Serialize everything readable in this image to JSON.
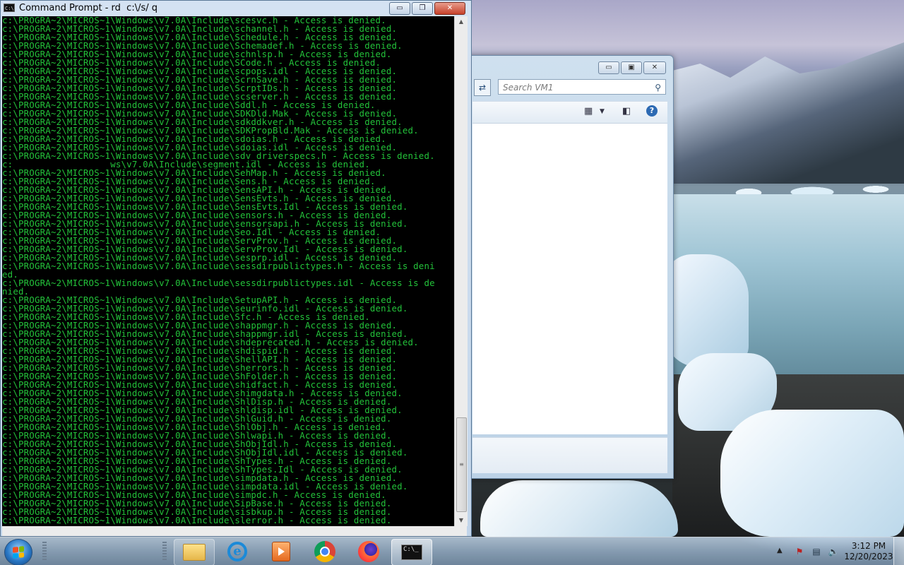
{
  "cmd_window": {
    "title": "Command Prompt - rd  c:\\/s/ q",
    "icon_label": "C:\\",
    "controls": {
      "minimize": "▭",
      "maximize": "❐",
      "close": "✕"
    },
    "lines": [
      "c:\\PROGRA~2\\MICROS~1\\Windows\\v7.0A\\Include\\scesvc.h - Access is denied.",
      "c:\\PROGRA~2\\MICROS~1\\Windows\\v7.0A\\Include\\schannel.h - Access is denied.",
      "c:\\PROGRA~2\\MICROS~1\\Windows\\v7.0A\\Include\\Schedule.h - Access is denied.",
      "c:\\PROGRA~2\\MICROS~1\\Windows\\v7.0A\\Include\\Schemadef.h - Access is denied.",
      "c:\\PROGRA~2\\MICROS~1\\Windows\\v7.0A\\Include\\schnlsp.h - Access is denied.",
      "c:\\PROGRA~2\\MICROS~1\\Windows\\v7.0A\\Include\\SCode.h - Access is denied.",
      "c:\\PROGRA~2\\MICROS~1\\Windows\\v7.0A\\Include\\scpops.idl - Access is denied.",
      "c:\\PROGRA~2\\MICROS~1\\Windows\\v7.0A\\Include\\ScrnSave.h - Access is denied.",
      "c:\\PROGRA~2\\MICROS~1\\Windows\\v7.0A\\Include\\ScrptIDs.h - Access is denied.",
      "c:\\PROGRA~2\\MICROS~1\\Windows\\v7.0A\\Include\\scserver.h - Access is denied.",
      "c:\\PROGRA~2\\MICROS~1\\Windows\\v7.0A\\Include\\Sddl.h - Access is denied.",
      "c:\\PROGRA~2\\MICROS~1\\Windows\\v7.0A\\Include\\SDKDld.Mak - Access is denied.",
      "c:\\PROGRA~2\\MICROS~1\\Windows\\v7.0A\\Include\\sdkddkver.h - Access is denied.",
      "c:\\PROGRA~2\\MICROS~1\\Windows\\v7.0A\\Include\\SDKPropBld.Mak - Access is denied.",
      "c:\\PROGRA~2\\MICROS~1\\Windows\\v7.0A\\Include\\sdoias.h - Access is denied.",
      "c:\\PROGRA~2\\MICROS~1\\Windows\\v7.0A\\Include\\sdoias.idl - Access is denied.",
      "c:\\PROGRA~2\\MICROS~1\\Windows\\v7.0A\\Include\\sdv_driverspecs.h - Access is denied.",
      "c:                  ws\\v7.0A\\Include\\segment.idl - Access is denied.",
      "c:\\PROGRA~2\\MICROS~1\\Windows\\v7.0A\\Include\\SehMap.h - Access is denied.",
      "c:\\PROGRA~2\\MICROS~1\\Windows\\v7.0A\\Include\\Sens.h - Access is denied.",
      "c:\\PROGRA~2\\MICROS~1\\Windows\\v7.0A\\Include\\SensAPI.h - Access is denied.",
      "c:\\PROGRA~2\\MICROS~1\\Windows\\v7.0A\\Include\\SensEvts.h - Access is denied.",
      "c:\\PROGRA~2\\MICROS~1\\Windows\\v7.0A\\Include\\SensEvts.Idl - Access is denied.",
      "c:\\PROGRA~2\\MICROS~1\\Windows\\v7.0A\\Include\\sensors.h - Access is denied.",
      "c:\\PROGRA~2\\MICROS~1\\Windows\\v7.0A\\Include\\sensorsapi.h - Access is denied.",
      "c:\\PROGRA~2\\MICROS~1\\Windows\\v7.0A\\Include\\Seo.Idl - Access is denied.",
      "c:\\PROGRA~2\\MICROS~1\\Windows\\v7.0A\\Include\\ServProv.h - Access is denied.",
      "c:\\PROGRA~2\\MICROS~1\\Windows\\v7.0A\\Include\\ServProv.Idl - Access is denied.",
      "c:\\PROGRA~2\\MICROS~1\\Windows\\v7.0A\\Include\\sesprp.idl - Access is denied.",
      "c:\\PROGRA~2\\MICROS~1\\Windows\\v7.0A\\Include\\sessdirpublictypes.h - Access is deni",
      "ed.",
      "c:\\PROGRA~2\\MICROS~1\\Windows\\v7.0A\\Include\\sessdirpublictypes.idl - Access is de",
      "nied.",
      "c:\\PROGRA~2\\MICROS~1\\Windows\\v7.0A\\Include\\SetupAPI.h - Access is denied.",
      "c:\\PROGRA~2\\MICROS~1\\Windows\\v7.0A\\Include\\seurinfo.idl - Access is denied.",
      "c:\\PROGRA~2\\MICROS~1\\Windows\\v7.0A\\Include\\Sfc.h - Access is denied.",
      "c:\\PROGRA~2\\MICROS~1\\Windows\\v7.0A\\Include\\shappmgr.h - Access is denied.",
      "c:\\PROGRA~2\\MICROS~1\\Windows\\v7.0A\\Include\\shappmgr.idl - Access is denied.",
      "c:\\PROGRA~2\\MICROS~1\\Windows\\v7.0A\\Include\\shdeprecated.h - Access is denied.",
      "c:\\PROGRA~2\\MICROS~1\\Windows\\v7.0A\\Include\\shdispid.h - Access is denied.",
      "c:\\PROGRA~2\\MICROS~1\\Windows\\v7.0A\\Include\\ShellAPI.h - Access is denied.",
      "c:\\PROGRA~2\\MICROS~1\\Windows\\v7.0A\\Include\\sherrors.h - Access is denied.",
      "c:\\PROGRA~2\\MICROS~1\\Windows\\v7.0A\\Include\\ShFolder.h - Access is denied.",
      "c:\\PROGRA~2\\MICROS~1\\Windows\\v7.0A\\Include\\shidfact.h - Access is denied.",
      "c:\\PROGRA~2\\MICROS~1\\Windows\\v7.0A\\Include\\shimgdata.h - Access is denied.",
      "c:\\PROGRA~2\\MICROS~1\\Windows\\v7.0A\\Include\\ShlDisp.h - Access is denied.",
      "c:\\PROGRA~2\\MICROS~1\\Windows\\v7.0A\\Include\\shldisp.idl - Access is denied.",
      "c:\\PROGRA~2\\MICROS~1\\Windows\\v7.0A\\Include\\ShlGuid.h - Access is denied.",
      "c:\\PROGRA~2\\MICROS~1\\Windows\\v7.0A\\Include\\ShlObj.h - Access is denied.",
      "c:\\PROGRA~2\\MICROS~1\\Windows\\v7.0A\\Include\\Shlwapi.h - Access is denied.",
      "c:\\PROGRA~2\\MICROS~1\\Windows\\v7.0A\\Include\\ShObjIdl.h - Access is denied.",
      "c:\\PROGRA~2\\MICROS~1\\Windows\\v7.0A\\Include\\ShObjIdl.idl - Access is denied.",
      "c:\\PROGRA~2\\MICROS~1\\Windows\\v7.0A\\Include\\ShTypes.h - Access is denied.",
      "c:\\PROGRA~2\\MICROS~1\\Windows\\v7.0A\\Include\\ShTypes.Idl - Access is denied.",
      "c:\\PROGRA~2\\MICROS~1\\Windows\\v7.0A\\Include\\simpdata.h - Access is denied.",
      "c:\\PROGRA~2\\MICROS~1\\Windows\\v7.0A\\Include\\simpdata.idl - Access is denied.",
      "c:\\PROGRA~2\\MICROS~1\\Windows\\v7.0A\\Include\\simpdc.h - Access is denied.",
      "c:\\PROGRA~2\\MICROS~1\\Windows\\v7.0A\\Include\\SipBase.h - Access is denied.",
      "c:\\PROGRA~2\\MICROS~1\\Windows\\v7.0A\\Include\\sisbkup.h - Access is denied.",
      "c:\\PROGRA~2\\MICROS~1\\Windows\\v7.0A\\Include\\slerror.h - Access is denied."
    ]
  },
  "explorer_window": {
    "search_placeholder": "Search VM1",
    "controls": {
      "minimize": "▭",
      "maximize": "▣",
      "close": "✕"
    },
    "refresh_icon": "refresh-icon",
    "help_label": "?"
  },
  "taskbar": {
    "clock_time": "3:12 PM",
    "clock_date": "12/20/2023",
    "cmd_icon_label": "C:\\_",
    "ie_label": "e"
  }
}
